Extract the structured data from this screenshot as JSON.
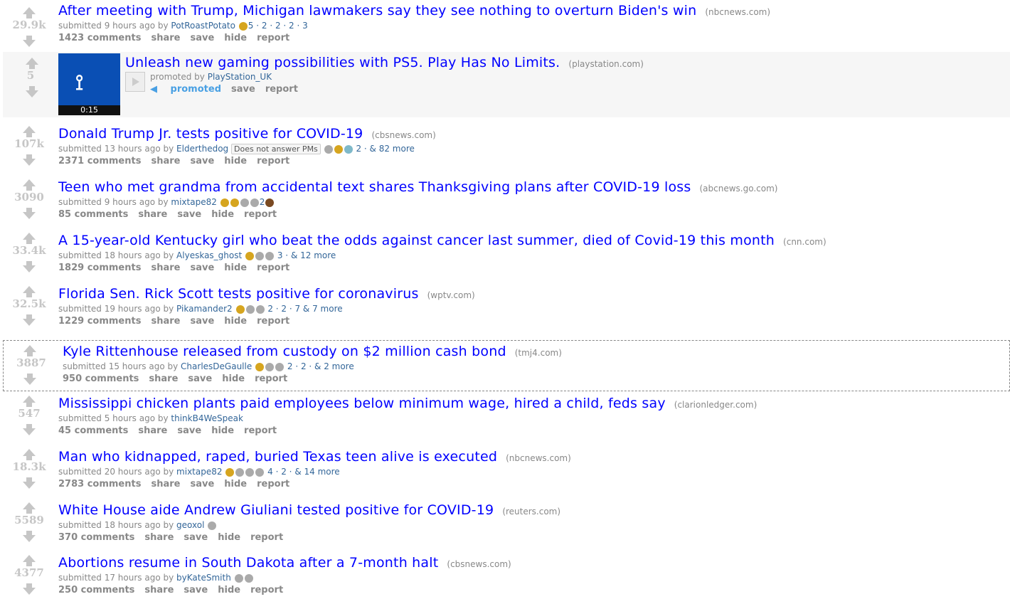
{
  "posts": [
    {
      "score": "29.9k",
      "title": "After meeting with Trump, Michigan lawmakers say they see nothing to overturn Biden's win",
      "domain": "(nbcnews.com)",
      "submitted": "submitted 9 hours ago by",
      "author": "PotRoastPotato",
      "awards": "5 · 2 · 2 · 2 · 3",
      "comments": "1423 comments"
    },
    {
      "score": "107k",
      "title": "Donald Trump Jr. tests positive for COVID-19",
      "domain": "(cbsnews.com)",
      "submitted": "submitted 13 hours ago by",
      "author": "Elderthedog",
      "flair": "Does not answer PMs",
      "awards": "2 · & 82 more",
      "comments": "2371 comments"
    },
    {
      "score": "3090",
      "title": "Teen who met grandma from accidental text shares Thanksgiving plans after COVID-19 loss",
      "domain": "(abcnews.go.com)",
      "submitted": "submitted 9 hours ago by",
      "author": "mixtape82",
      "awards": "2",
      "comments": "85 comments"
    },
    {
      "score": "33.4k",
      "title": "A 15-year-old Kentucky girl who beat the odds against cancer last summer, died of Covid-19 this month",
      "domain": "(cnn.com)",
      "submitted": "submitted 18 hours ago by",
      "author": "Alyeskas_ghost",
      "awards": "3 · & 12 more",
      "comments": "1829 comments"
    },
    {
      "score": "32.5k",
      "title": "Florida Sen. Rick Scott tests positive for coronavirus",
      "domain": "(wptv.com)",
      "submitted": "submitted 19 hours ago by",
      "author": "Pikamander2",
      "awards": "2 · 2 · 7 & 7 more",
      "comments": "1229 comments"
    },
    {
      "score": "3887",
      "title": "Kyle Rittenhouse released from custody on $2 million cash bond",
      "domain": "(tmj4.com)",
      "submitted": "submitted 15 hours ago by",
      "author": "CharlesDeGaulle",
      "awards": "2 · 2 · & 2 more",
      "comments": "950 comments"
    },
    {
      "score": "547",
      "title": "Mississippi chicken plants paid employees below minimum wage, hired a child, feds say",
      "domain": "(clarionledger.com)",
      "submitted": "submitted 5 hours ago by",
      "author": "thinkB4WeSpeak",
      "awards": "",
      "comments": "45 comments"
    },
    {
      "score": "18.3k",
      "title": "Man who kidnapped, raped, buried Texas teen alive is executed",
      "domain": "(nbcnews.com)",
      "submitted": "submitted 20 hours ago by",
      "author": "mixtape82",
      "awards": "4 · 2 · & 14 more",
      "comments": "2783 comments"
    },
    {
      "score": "5589",
      "title": "White House aide Andrew Giuliani tested positive for COVID-19",
      "domain": "(reuters.com)",
      "submitted": "submitted 18 hours ago by",
      "author": "geoxol",
      "awards": "",
      "comments": "370 comments"
    },
    {
      "score": "4377",
      "title": "Abortions resume in South Dakota after a 7-month halt",
      "domain": "(cbsnews.com)",
      "submitted": "submitted 17 hours ago by",
      "author": "byKateSmith",
      "awards": "",
      "comments": "250 comments"
    }
  ],
  "ad": {
    "score": "5",
    "title": "Unleash new gaming possibilities with PS5. Play Has No Limits.",
    "domain": "(playstation.com)",
    "promoted_by": "promoted by",
    "author": "PlayStation_UK",
    "promoted": "promoted",
    "save": "save",
    "report": "report",
    "duration": "0:15"
  },
  "buttons": {
    "share": "share",
    "save": "save",
    "hide": "hide",
    "report": "report"
  }
}
